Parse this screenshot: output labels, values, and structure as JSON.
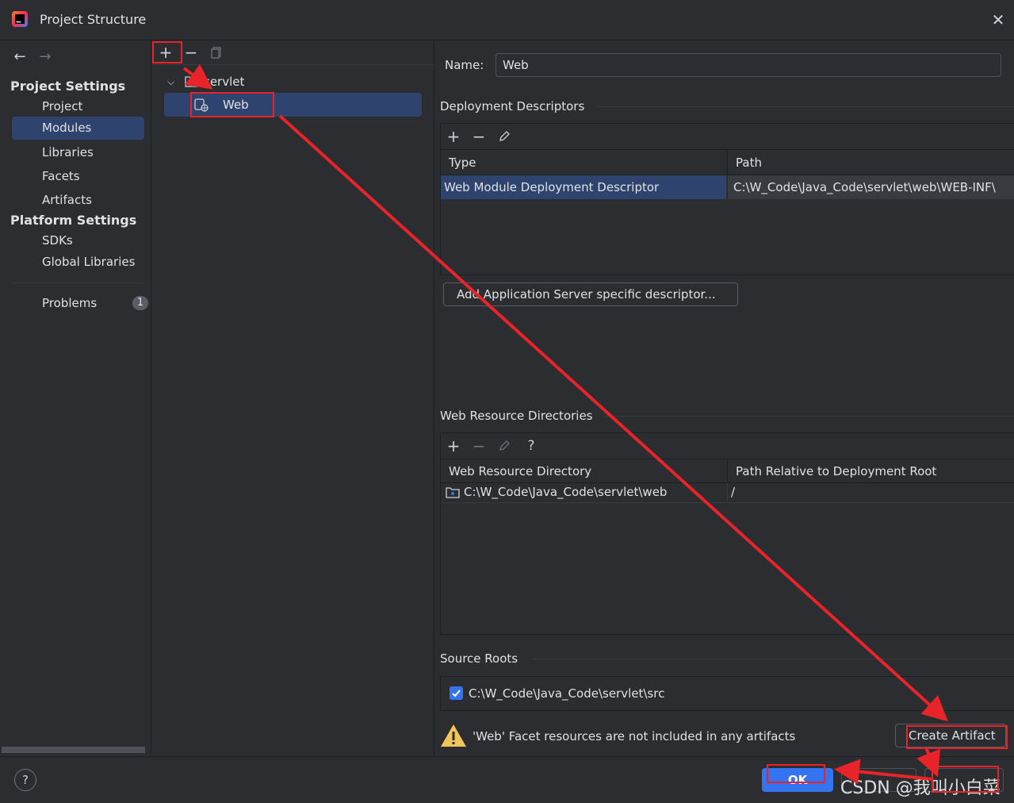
{
  "window": {
    "title": "Project Structure"
  },
  "sidebar": {
    "project_settings_title": "Project Settings",
    "project_settings_items": [
      {
        "label": "Project"
      },
      {
        "label": "Modules",
        "selected": true
      },
      {
        "label": "Libraries"
      },
      {
        "label": "Facets"
      },
      {
        "label": "Artifacts"
      }
    ],
    "platform_settings_title": "Platform Settings",
    "platform_settings_items": [
      {
        "label": "SDKs"
      },
      {
        "label": "Global Libraries"
      }
    ],
    "problems_label": "Problems",
    "problems_count": "1"
  },
  "tree": {
    "root_label": "servlet",
    "child_label": "Web"
  },
  "facet": {
    "name_label": "Name:",
    "name_value": "Web",
    "deployment_descriptors_title": "Deployment Descriptors",
    "dd_columns": [
      "Type",
      "Path"
    ],
    "dd_rows": [
      {
        "type": "Web Module Deployment Descriptor",
        "path": "C:\\W_Code\\Java_Code\\servlet\\web\\WEB-INF\\"
      }
    ],
    "add_server_descriptor_button": "Add Application Server specific descriptor...",
    "web_resource_dirs_title": "Web Resource Directories",
    "wr_columns": [
      "Web Resource Directory",
      "Path Relative to Deployment Root"
    ],
    "wr_rows": [
      {
        "dir": "C:\\W_Code\\Java_Code\\servlet\\web",
        "rel": "/"
      }
    ],
    "source_roots_title": "Source Roots",
    "source_root_path": "C:\\W_Code\\Java_Code\\servlet\\src",
    "source_root_checked": true,
    "warning_text": "'Web' Facet resources are not included in any artifacts",
    "create_artifact_button": "Create Artifact"
  },
  "footer": {
    "help_label": "?",
    "ok_button": "OK",
    "watermark": "CSDN @我叫小白菜"
  },
  "colors": {
    "accent": "#3574f0",
    "selection": "#2e436e",
    "annotation_red": "#e8232a",
    "warning_yellow": "#f2c55c"
  }
}
